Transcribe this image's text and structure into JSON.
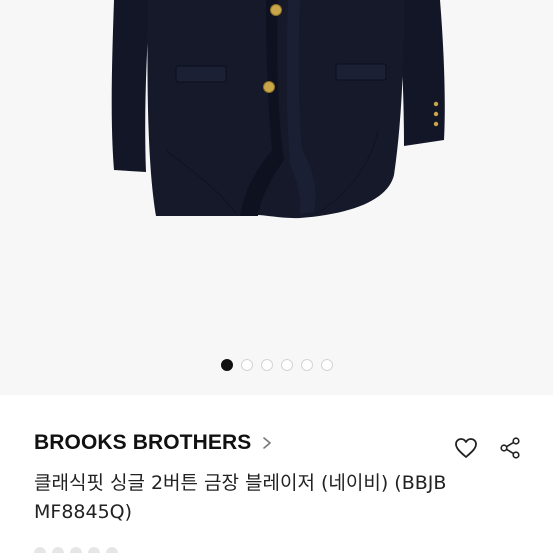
{
  "gallery": {
    "image_alt": "Navy single-breasted 2-button gold-button blazer",
    "slide_count": 6,
    "active_slide": 1,
    "colors": {
      "background": "#f7f7f7",
      "jacket": "#15192a",
      "button": "#c9a64a"
    }
  },
  "product": {
    "brand": "BROOKS BROTHERS",
    "title": "클래식핏 싱글 2버튼 금장 블레이저 (네이비) (BBJB MF8845Q)"
  },
  "actions": {
    "like_icon": "heart-icon",
    "share_icon": "share-icon"
  }
}
